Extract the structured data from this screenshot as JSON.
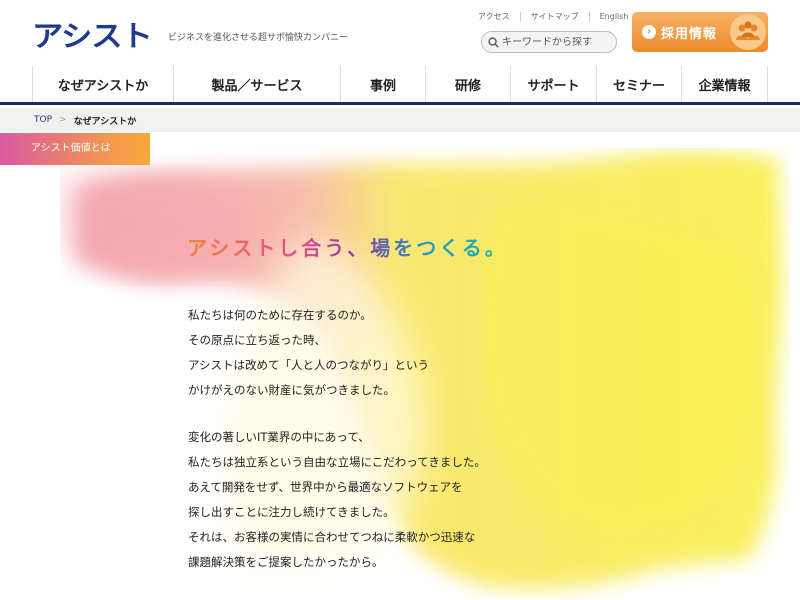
{
  "header": {
    "logo": "アシスト",
    "tagline": "ビジネスを進化させる超サポ愉快カンパニー",
    "top_links": [
      "アクセス",
      "サイトマップ",
      "English"
    ],
    "search_placeholder": "キーワードから探す",
    "recruit_label": "採用情報"
  },
  "nav": {
    "items": [
      "なぜアシストか",
      "製品／サービス",
      "事例",
      "研修",
      "サポート",
      "セミナー",
      "企業情報"
    ]
  },
  "breadcrumb": {
    "top": "TOP",
    "separator": ">",
    "current": "なぜアシストか"
  },
  "section_tab": "アシスト価値とは",
  "main": {
    "headline": "アシストし合う、場をつくる。",
    "paragraph1": [
      "私たちは何のために存在するのか。",
      "その原点に立ち返った時、",
      "アシストは改めて「人と人のつながり」という",
      "かけがえのない財産に気がつきました。"
    ],
    "paragraph2": [
      "変化の著しいIT業界の中にあって、",
      "私たちは独立系という自由な立場にこだわってきました。",
      "あえて開発をせず、世界中から最適なソフトウェアを",
      "探し出すことに注力し続けてきました。",
      "それは、お客様の実情に合わせてつねに柔軟かつ迅速な",
      "課題解決策をご提案したかったから。"
    ]
  },
  "colors": {
    "brand_navy": "#1f3a8c",
    "recruit_orange": "#ec8a2c",
    "wash_pink": "#f3a0a8",
    "wash_yellow": "#f7ec4a"
  },
  "icons": {
    "search": "search-icon",
    "recruit_arrow": "chevron-right-icon",
    "recruit_people": "people-icon"
  }
}
